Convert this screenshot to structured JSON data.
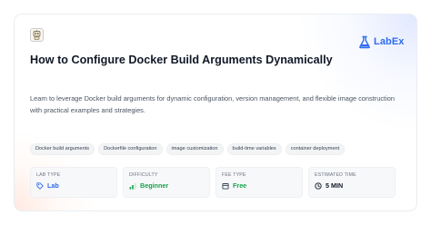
{
  "brand": {
    "name": "LabEx",
    "color": "#2e6bf0",
    "icon": "flask-icon"
  },
  "title": "How to Configure Docker Build Arguments Dynamically",
  "description": "Learn to leverage Docker build arguments for dynamic configuration, version management, and flexible image construction with practical examples and strategies.",
  "tags": [
    "Docker build arguments",
    "Dockerfile configuration",
    "image customization",
    "build-time variables",
    "container deployment"
  ],
  "info": {
    "lab_type": {
      "label": "LAB TYPE",
      "value": "Lab",
      "icon": "tag-icon",
      "color": "#2e6bf0"
    },
    "difficulty": {
      "label": "DIFFICULTY",
      "value": "Beginner",
      "icon": "signal-icon",
      "color": "#16a34a"
    },
    "fee_type": {
      "label": "FEE TYPE",
      "value": "Free",
      "icon": "box-icon",
      "color": "#16a34a"
    },
    "estimated_time": {
      "label": "ESTIMATED TIME",
      "value": "5 MIN",
      "icon": "clock-icon",
      "color": "#111827"
    }
  }
}
